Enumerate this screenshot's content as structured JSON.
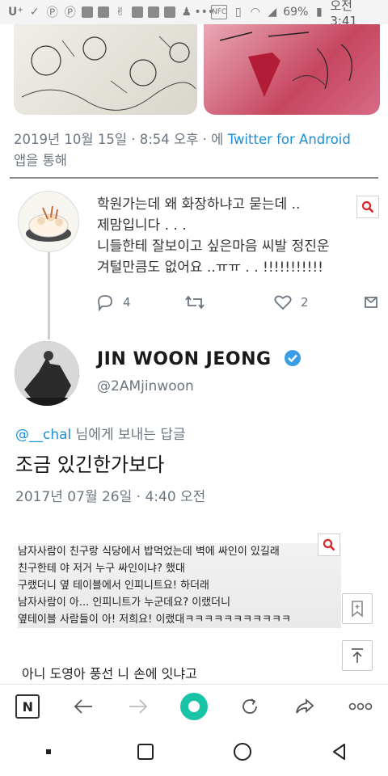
{
  "status_bar": {
    "carrier": "U⁺",
    "battery_percent": "69%",
    "time": "오전 3:41",
    "icons": [
      "check-icon",
      "pinterest-icon",
      "pinterest-icon",
      "square-icon",
      "f-icon",
      "peace-icon",
      "f-icon",
      "f-icon",
      "square-icon",
      "person-icon",
      "more-icon",
      "nfc-icon",
      "vibrate-icon",
      "wifi-icon",
      "signal-icon",
      "battery-icon"
    ]
  },
  "tweet_meta": {
    "date": "2019년 10월 15일 · 8:54 오후 · 에",
    "source": "Twitter for Android",
    "suffix": "앱을 통해"
  },
  "tweet1": {
    "line1": "학원가는데 왜 화장하냐고 묻는데 ..",
    "line2": "제맘입니다 . . .",
    "line3": "니들한테 잘보이고 싶은마음 씨발 정진운",
    "line4": "겨털만큼도 없어요 ..ㅠㅠ . . !!!!!!!!!!!",
    "reply_count": "4",
    "like_count": "2"
  },
  "profile": {
    "display_name": "JIN WOON JEONG",
    "handle": "@2AMjinwoon",
    "replying_user": "@__chal",
    "replying_suffix": " 님에게 보내는 답글",
    "reply_text": "조금 있긴한가보다",
    "reply_time": "2017년 07월 26일 · 4:40 오전"
  },
  "story": {
    "lines": [
      "남자사람이 친구랑 식당에서 밥먹었는데 벽에  싸인이 있길래",
      "친구한테 야 저거 누구 싸인이냐? 했대",
      "구랬더니 옆 테이블에서 인피니트요! 하더래",
      "남자사람이 아... 인피니트가 누군데요? 이랬더니",
      "옆테이블 사람들이 아! 저희요! 이랬대ㅋㅋㅋㅋㅋㅋㅋㅋㅋㅋㅋ"
    ],
    "bottom_line": "아니 도영아 풍선 니 손에 잇냐고"
  },
  "toolbar": {
    "n_label": "N"
  },
  "colors": {
    "link": "#1d8fd6",
    "verified": "#3a9ee6",
    "accent_green": "#18c3a6",
    "search_red": "#d6282b"
  }
}
